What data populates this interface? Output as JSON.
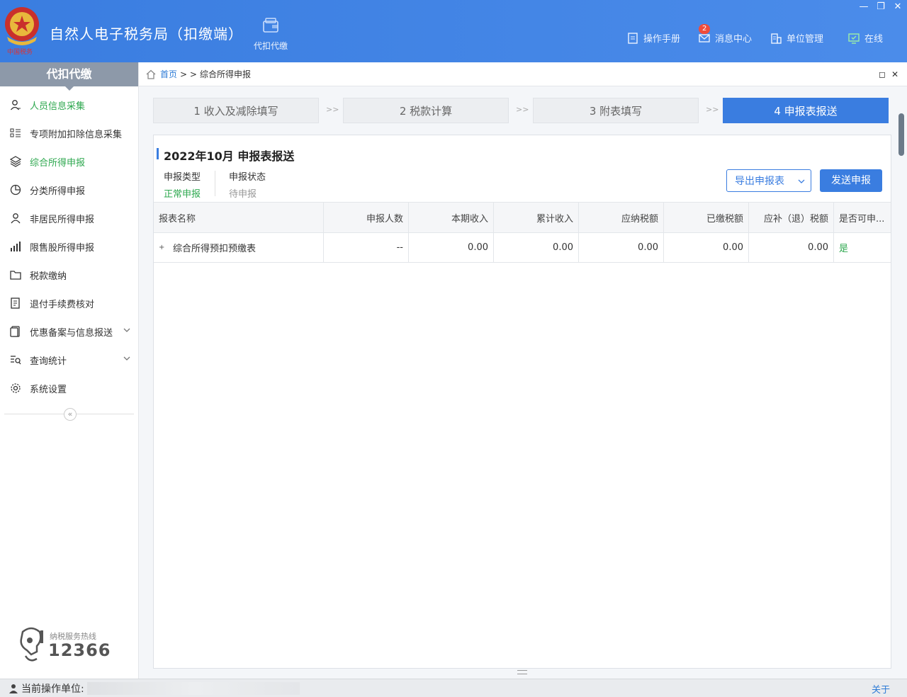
{
  "header": {
    "app_title": "自然人电子税务局（扣缴端）",
    "module_label": "代扣代缴",
    "toolbar": {
      "manual": "操作手册",
      "messages": "消息中心",
      "messages_badge": "2",
      "unit": "单位管理",
      "online": "在线"
    }
  },
  "window": {
    "minimize": "—",
    "restore": "❐",
    "close": "✕"
  },
  "sidebar": {
    "title": "代扣代缴",
    "items": [
      {
        "label": "人员信息采集",
        "icon": "person-icon",
        "state": "active"
      },
      {
        "label": "专项附加扣除信息采集",
        "icon": "grid-list-icon"
      },
      {
        "label": "综合所得申报",
        "icon": "layers-icon",
        "state": "selected"
      },
      {
        "label": "分类所得申报",
        "icon": "pie-chart-icon"
      },
      {
        "label": "非居民所得申报",
        "icon": "user-outline-icon"
      },
      {
        "label": "限售股所得申报",
        "icon": "bar-chart-icon"
      },
      {
        "label": "税款缴纳",
        "icon": "folder-icon"
      },
      {
        "label": "退付手续费核对",
        "icon": "receipt-icon"
      },
      {
        "label": "优惠备案与信息报送",
        "icon": "document-icon",
        "expandable": true
      },
      {
        "label": "查询统计",
        "icon": "search-list-icon",
        "expandable": true
      },
      {
        "label": "系统设置",
        "icon": "gear-icon"
      }
    ],
    "collapse_glyph": "«",
    "hotline_label": "纳税服务热线",
    "hotline_number": "12366"
  },
  "breadcrumb": {
    "home": "首页",
    "separator": "> >",
    "current": "综合所得申报"
  },
  "steps": [
    {
      "label": "1 收入及减除填写"
    },
    {
      "label": "2 税款计算"
    },
    {
      "label": "3 附表填写"
    },
    {
      "label": "4 申报表报送",
      "active": true
    }
  ],
  "step_arrow": ">>",
  "panel": {
    "title": "2022年10月  申报表报送",
    "declare_type_label": "申报类型",
    "declare_type_value": "正常申报",
    "declare_status_label": "申报状态",
    "declare_status_value": "待申报",
    "export_button": "导出申报表",
    "send_button": "发送申报"
  },
  "table": {
    "columns": [
      "报表名称",
      "申报人数",
      "本期收入",
      "累计收入",
      "应纳税额",
      "已缴税额",
      "应补（退）税额",
      "是否可申..."
    ],
    "rows": [
      [
        "综合所得预扣预缴表",
        "--",
        "0.00",
        "0.00",
        "0.00",
        "0.00",
        "0.00",
        "是"
      ]
    ]
  },
  "statusbar": {
    "unit_label": "当前操作单位:",
    "about": "关于"
  },
  "colors": {
    "brand": "#3a7de0",
    "active_green": "#2ea84f",
    "link_blue": "#2d7bd6"
  }
}
